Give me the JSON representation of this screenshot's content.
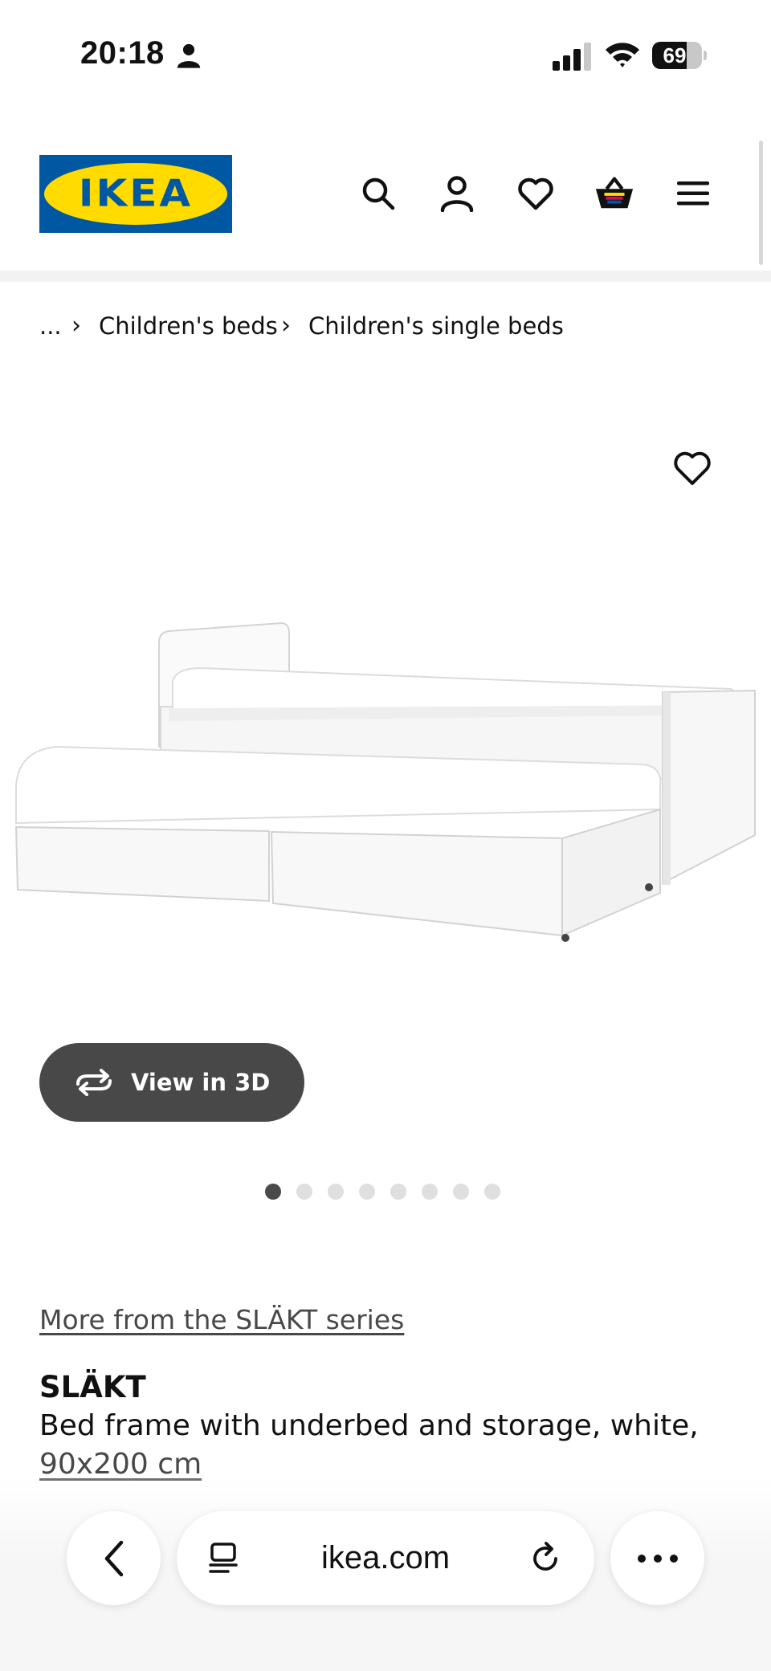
{
  "status_bar": {
    "time": "20:18",
    "battery_level": "69",
    "battery_fraction": 0.69
  },
  "header": {
    "logo_text": "IKEA",
    "icons": [
      "search-icon",
      "account-icon",
      "heart-icon",
      "basket-icon",
      "menu-icon"
    ]
  },
  "breadcrumb": {
    "items": [
      "...",
      "Children's beds",
      "Children's single beds"
    ]
  },
  "gallery": {
    "view_3d_label": "View in 3D",
    "dot_count": 8,
    "active_dot": 0
  },
  "product": {
    "series_link": "More from the SLÄKT series",
    "name": "SLÄKT",
    "description": "Bed frame with underbed and storage, white,",
    "size": "90x200 cm"
  },
  "browser": {
    "url": "ikea.com"
  },
  "colors": {
    "ikea_blue": "#0058a3",
    "ikea_yellow": "#ffdb00",
    "button_dark": "#484848"
  }
}
